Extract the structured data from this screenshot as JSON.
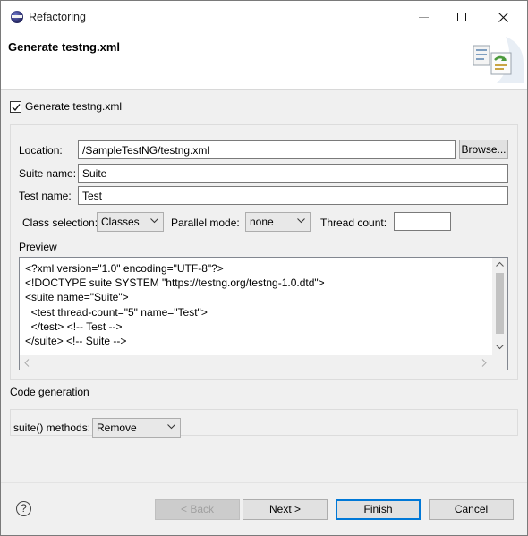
{
  "window": {
    "title": "Refactoring"
  },
  "header": {
    "title": "Generate testng.xml"
  },
  "generate_checkbox": {
    "label": "Generate testng.xml",
    "checked": true
  },
  "form": {
    "location_label": "Location:",
    "location_value": "/SampleTestNG/testng.xml",
    "browse_label": "Browse...",
    "suite_label": "Suite name:",
    "suite_value": "Suite",
    "test_label": "Test name:",
    "test_value": "Test",
    "class_selection_label": "Class selection:",
    "class_selection_value": "Classes",
    "parallel_label": "Parallel mode:",
    "parallel_value": "none",
    "thread_label": "Thread count:",
    "thread_value": ""
  },
  "preview": {
    "label": "Preview",
    "lines": [
      "<?xml version=\"1.0\" encoding=\"UTF-8\"?>",
      "<!DOCTYPE suite SYSTEM \"https://testng.org/testng-1.0.dtd\">",
      "<suite name=\"Suite\">",
      "  <test thread-count=\"5\" name=\"Test\">",
      "  </test> <!-- Test -->",
      "</suite> <!-- Suite -->"
    ]
  },
  "code_generation": {
    "label": "Code generation",
    "suite_methods_label": "suite() methods:",
    "suite_methods_value": "Remove"
  },
  "footer": {
    "help": "?",
    "back": "< Back",
    "next": "Next >",
    "finish": "Finish",
    "cancel": "Cancel"
  }
}
